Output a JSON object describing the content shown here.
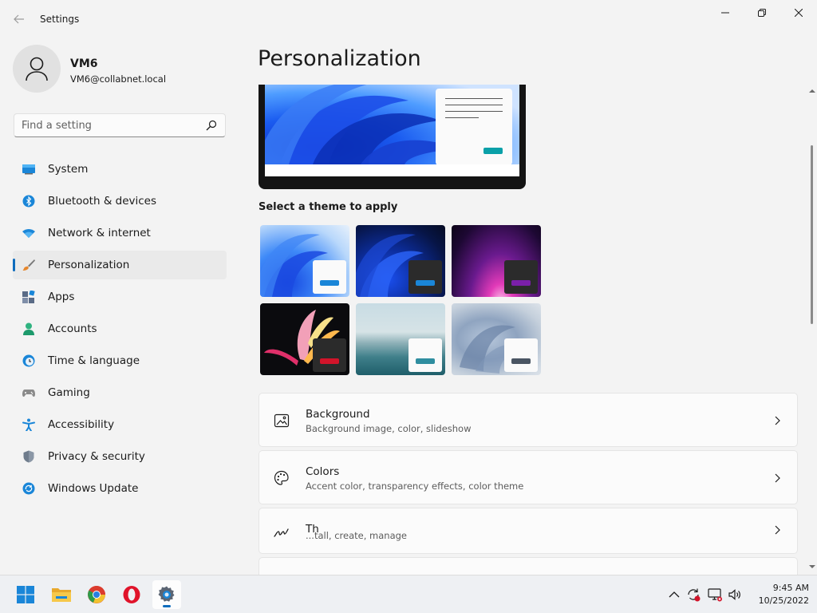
{
  "window": {
    "title": "Settings",
    "back_icon": "back-arrow-icon",
    "controls": [
      "minimize-icon",
      "restore-icon",
      "close-icon"
    ]
  },
  "profile": {
    "name": "VM6",
    "email": "VM6@collabnet.local"
  },
  "search": {
    "placeholder": "Find a setting",
    "value": ""
  },
  "sidebar": {
    "items": [
      {
        "label": "System",
        "icon": "monitor-icon"
      },
      {
        "label": "Bluetooth & devices",
        "icon": "bluetooth-icon"
      },
      {
        "label": "Network & internet",
        "icon": "wifi-icon"
      },
      {
        "label": "Personalization",
        "icon": "paintbrush-icon",
        "active": true
      },
      {
        "label": "Apps",
        "icon": "apps-icon"
      },
      {
        "label": "Accounts",
        "icon": "person-icon"
      },
      {
        "label": "Time & language",
        "icon": "globe-clock-icon"
      },
      {
        "label": "Gaming",
        "icon": "gamepad-icon"
      },
      {
        "label": "Accessibility",
        "icon": "accessibility-icon"
      },
      {
        "label": "Privacy & security",
        "icon": "shield-icon"
      },
      {
        "label": "Windows Update",
        "icon": "update-icon"
      }
    ]
  },
  "main": {
    "title": "Personalization",
    "theme_section_label": "Select a theme to apply",
    "cards": [
      {
        "title": "Background",
        "subtitle": "Background image, color, slideshow",
        "icon": "image-icon"
      },
      {
        "title": "Colors",
        "subtitle": "Accent color, transparency effects, color theme",
        "icon": "palette-icon"
      },
      {
        "title": "Th",
        "subtitle": "...tall, create, manage",
        "icon": "brush-stroke-icon"
      }
    ]
  },
  "colors": {
    "accent": "#0f6cbd",
    "window_bg": "#f3f3f3",
    "card_bg": "#fbfbfb"
  },
  "taskbar": {
    "apps": [
      "windows-start-icon",
      "file-explorer-icon",
      "chrome-icon",
      "opera-icon",
      "settings-gear-icon"
    ],
    "tray": [
      "chevron-up-icon",
      "sync-icon",
      "network-icon",
      "volume-icon"
    ],
    "time": "9:45 AM",
    "date": "10/25/2022"
  }
}
